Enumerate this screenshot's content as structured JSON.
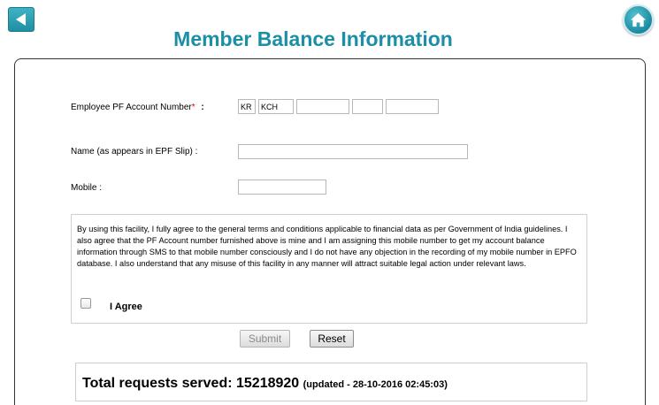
{
  "header": {
    "title": "Member Balance Information",
    "back_icon": "back-arrow-icon",
    "home_icon": "home-icon",
    "accent_color": "#1b8fa6"
  },
  "form": {
    "pf_account_label": "Employee PF Account Number",
    "pf_account_required_mark": "*",
    "pf_account_colon": ":",
    "pf_account_fields": [
      "KR",
      "KCH",
      "",
      "",
      ""
    ],
    "name_label": "Name (as appears in EPF Slip) :",
    "name_value": "",
    "mobile_label": "Mobile :",
    "mobile_value": ""
  },
  "terms": {
    "text": "By using this facility, I fully agree to the general terms and conditions applicable to financial data as per Government of India guidelines. I also agree that the PF Account number furnished above is mine and I am assigning this mobile number to get my account balance information through SMS to that mobile number consciously and I do not have any objection in the recording of my mobile number in EPFO database. I also understand that any misuse of this facility in any manner will attract suitable legal action under relevant laws.",
    "agree_label": "I Agree",
    "agree_checked": false
  },
  "actions": {
    "submit_label": "Submit",
    "reset_label": "Reset"
  },
  "stats": {
    "label": "Total requests served:",
    "count": "15218920",
    "updated": "(updated - 28-10-2016 02:45:03)"
  }
}
